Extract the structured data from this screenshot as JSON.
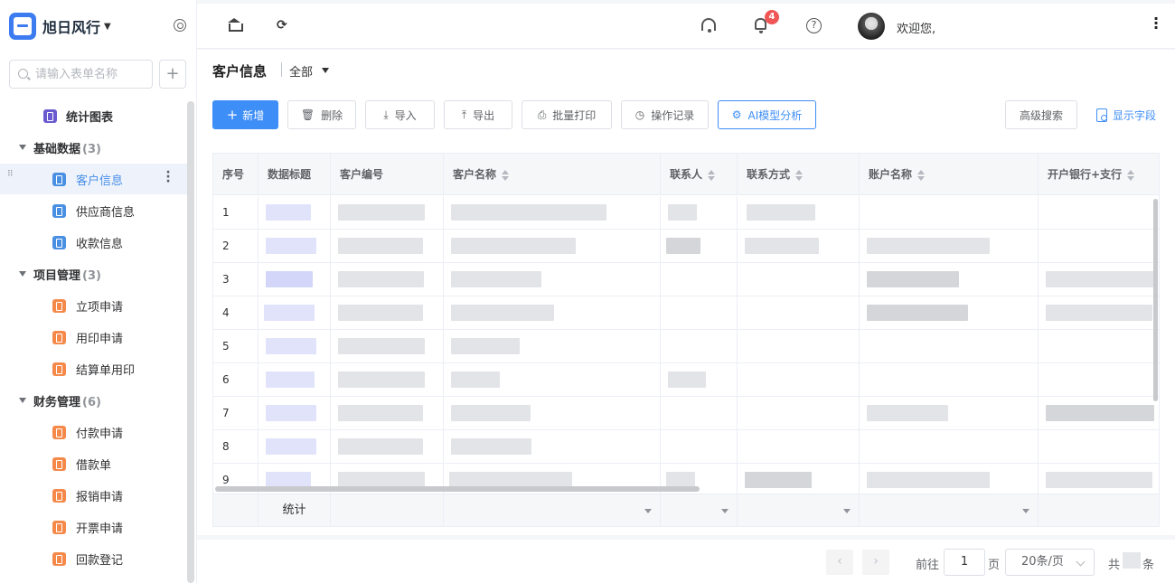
{
  "sidebar": {
    "app_name": "旭日风行",
    "search_placeholder": "请输入表单名称",
    "add_symbol": "+",
    "stats_item": "统计图表",
    "groups": [
      {
        "label": "基础数据",
        "count": "(3)",
        "items": [
          "客户信息",
          "供应商信息",
          "收款信息"
        ]
      },
      {
        "label": "项目管理",
        "count": "(3)",
        "items": [
          "立项申请",
          "用印申请",
          "结算单用印"
        ]
      },
      {
        "label": "财务管理",
        "count": "(6)",
        "items": [
          "付款申请",
          "借款单",
          "报销申请",
          "开票申请",
          "回款登记"
        ]
      }
    ],
    "active_item": "客户信息"
  },
  "topbar": {
    "notification_count": "4",
    "welcome": "欢迎您,",
    "help_symbol": "?"
  },
  "main": {
    "title": "客户信息",
    "view_filter": "全部",
    "toolbar": {
      "new": "新增",
      "delete": "删除",
      "import": "导入",
      "export": "导出",
      "batch_print": "批量打印",
      "operation_log": "操作记录",
      "ai_analysis": "AI模型分析",
      "advanced_search": "高级搜索",
      "show_fields": "显示字段"
    },
    "table": {
      "columns": [
        "序号",
        "数据标题",
        "客户编号",
        "客户名称",
        "联系人",
        "联系方式",
        "账户名称",
        "开户银行+支行"
      ],
      "row_numbers": [
        "1",
        "2",
        "3",
        "4",
        "5",
        "6",
        "7",
        "8",
        "9"
      ],
      "footer_label": "统计"
    }
  },
  "pagination": {
    "goto_label": "前往",
    "current_page": "1",
    "page_unit": "页",
    "page_size": "20条/页",
    "total_prefix": "共",
    "total_suffix": "条"
  }
}
